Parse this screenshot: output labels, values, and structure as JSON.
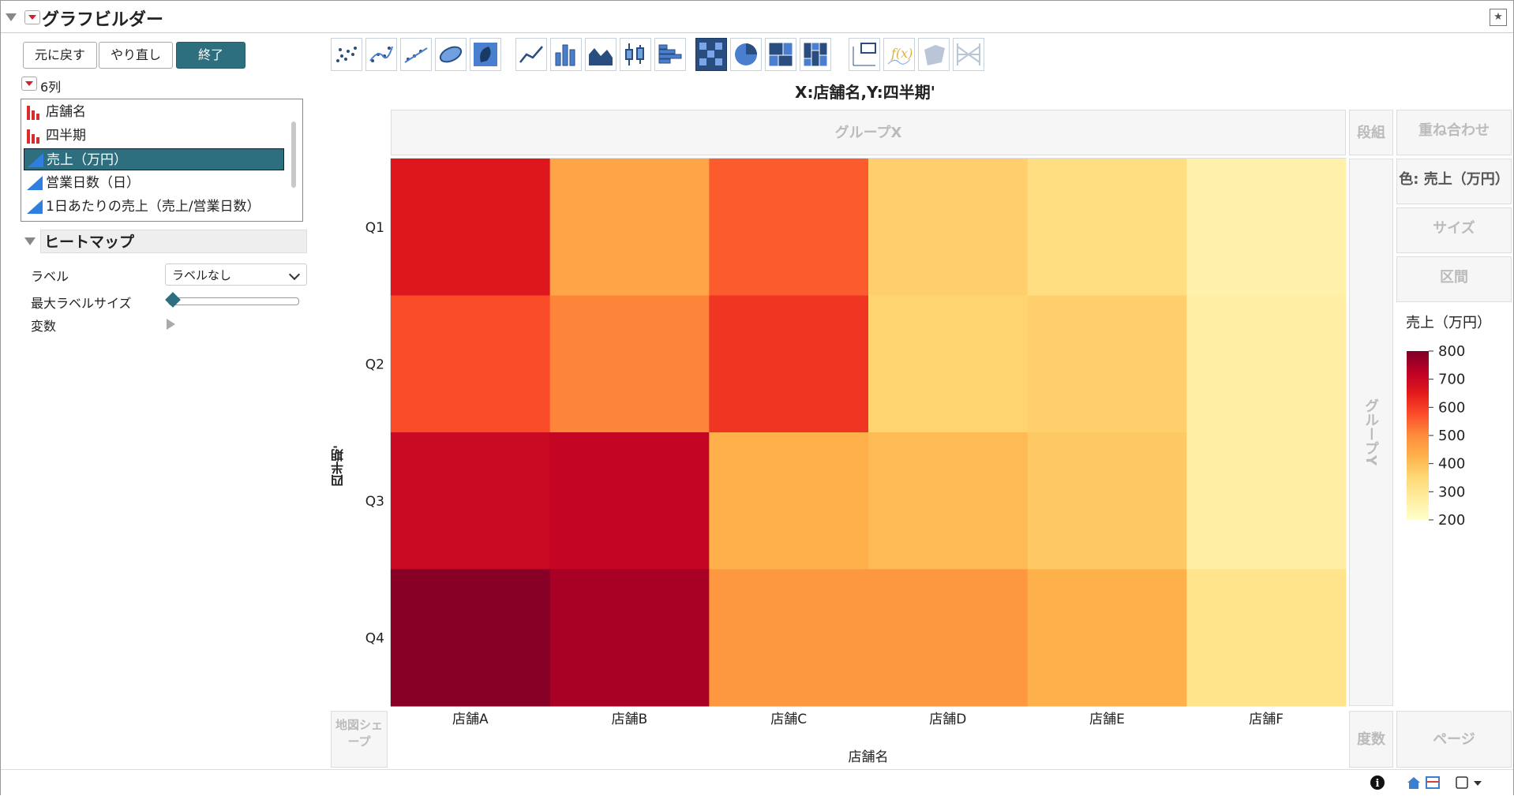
{
  "window": {
    "title": "グラフビルダー"
  },
  "toolbar": {
    "undo": "元に戻す",
    "redo": "やり直し",
    "done": "終了"
  },
  "columns": {
    "count_label": "6列",
    "items": [
      {
        "label": "店舗名",
        "type": "nominal"
      },
      {
        "label": "四半期",
        "type": "nominal"
      },
      {
        "label": "売上（万円）",
        "type": "continuous",
        "selected": true
      },
      {
        "label": "営業日数（日）",
        "type": "continuous"
      },
      {
        "label": "1日あたりの売上（売上/営業日数）",
        "type": "continuous"
      }
    ]
  },
  "heatmap_panel": {
    "title": "ヒートマップ",
    "label_caption": "ラベル",
    "label_value": "ラベルなし",
    "max_label_size_caption": "最大ラベルサイズ",
    "max_label_size_level": 0,
    "variables_caption": "変数"
  },
  "graph_types": [
    "points",
    "smoother",
    "line-of-fit",
    "ellipse",
    "contour",
    "line",
    "bar",
    "area",
    "box-plot",
    "histogram",
    "heatmap",
    "pie",
    "treemap",
    "mosaic",
    "caption-box",
    "formula",
    "map-shapes",
    "parallel"
  ],
  "graph": {
    "title": "X:店舗名,Y:四半期'",
    "zones": {
      "group_x": "グループX",
      "wrap": "段組",
      "overlay": "重ね合わせ",
      "color": "色: 売上（万円）",
      "size": "サイズ",
      "interval": "区間",
      "group_y": "グループY",
      "map_shape": "地図シェープ",
      "freq": "度数",
      "page": "ページ"
    },
    "x_axis_title": "店舗名",
    "y_axis_title": "四半期'"
  },
  "chart_data": {
    "type": "heatmap",
    "title": "X:店舗名,Y:四半期'",
    "xlabel": "店舗名",
    "ylabel": "四半期'",
    "x_categories": [
      "店舗A",
      "店舗B",
      "店舗C",
      "店舗D",
      "店舗E",
      "店舗F"
    ],
    "y_categories": [
      "Q1",
      "Q2",
      "Q3",
      "Q4"
    ],
    "values": [
      [
        660,
        450,
        560,
        370,
        330,
        260
      ],
      [
        580,
        510,
        610,
        360,
        370,
        270
      ],
      [
        700,
        710,
        430,
        410,
        380,
        270
      ],
      [
        790,
        750,
        480,
        480,
        430,
        310
      ]
    ],
    "color_scale": {
      "title": "売上（万円）",
      "min": 200,
      "max": 800,
      "ticks": [
        800,
        700,
        600,
        500,
        400,
        300,
        200
      ],
      "colors": [
        "#ffffcc",
        "#ffeda0",
        "#fed976",
        "#feb24c",
        "#fd8d3c",
        "#fc4e2a",
        "#e31a1c",
        "#bd0026",
        "#800026"
      ]
    }
  }
}
